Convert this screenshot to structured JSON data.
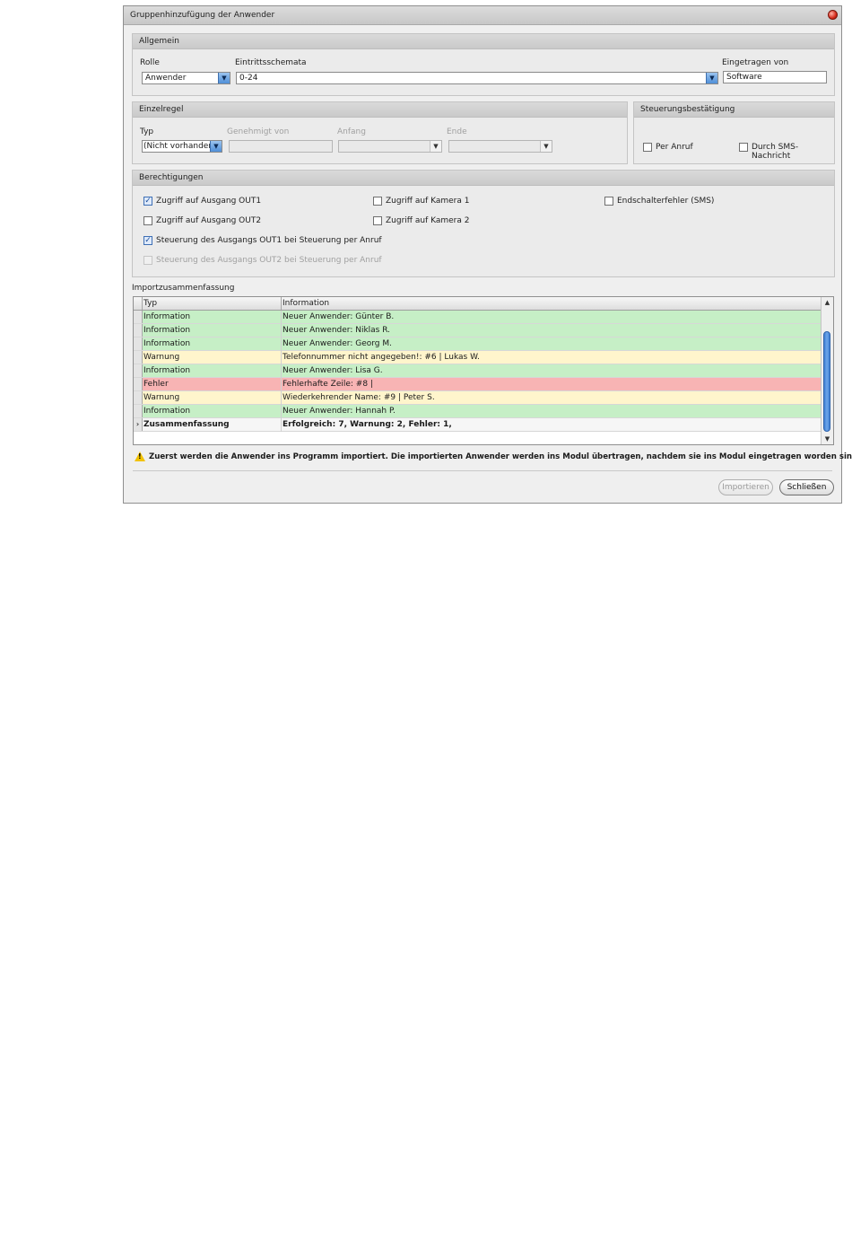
{
  "window": {
    "title": "Gruppenhinzufügung der Anwender"
  },
  "allgemein": {
    "header": "Allgemein",
    "role_label": "Rolle",
    "role_value": "Anwender",
    "schema_label": "Eintrittsschemata",
    "schema_value": "0-24",
    "registered_label": "Eingetragen von",
    "registered_value": "Software"
  },
  "einzelregel": {
    "header": "Einzelregel",
    "typ_label": "Typ",
    "typ_value": "(Nicht vorhanden)",
    "approved_label": "Genehmigt von",
    "start_label": "Anfang",
    "end_label": "Ende"
  },
  "steuerung": {
    "header": "Steuerungsbestätigung",
    "per_call": "Per Anruf",
    "per_sms": "Durch SMS-Nachricht"
  },
  "permissions": {
    "header": "Berechtigungen",
    "items": [
      {
        "label": "Zugriff auf Ausgang OUT1",
        "checked": true
      },
      {
        "label": "Zugriff auf Ausgang OUT2",
        "checked": false
      },
      {
        "label": "Steuerung des Ausgangs OUT1 bei Steuerung per Anruf",
        "checked": true
      },
      {
        "label": "Steuerung des Ausgangs OUT2 bei Steuerung per Anruf",
        "checked": false,
        "disabled": true
      },
      {
        "label": "Zugriff auf Kamera 1",
        "checked": false
      },
      {
        "label": "Zugriff auf Kamera 2",
        "checked": false
      },
      {
        "label": "Endschalterfehler (SMS)",
        "checked": false
      }
    ]
  },
  "import": {
    "section_label": "Importzusammenfassung",
    "columns": [
      "Typ",
      "Information"
    ],
    "rows": [
      {
        "type": "Information",
        "info": "Neuer Anwender: Günter B.",
        "kind": "info"
      },
      {
        "type": "Information",
        "info": "Neuer Anwender: Niklas R.",
        "kind": "info"
      },
      {
        "type": "Information",
        "info": "Neuer Anwender: Georg M.",
        "kind": "info"
      },
      {
        "type": "Warnung",
        "info": "Telefonnummer nicht angegeben!: #6 | Lukas W.",
        "kind": "warn"
      },
      {
        "type": "Information",
        "info": "Neuer Anwender: Lisa G.",
        "kind": "info"
      },
      {
        "type": "Fehler",
        "info": "Fehlerhafte Zeile: #8 |",
        "kind": "err"
      },
      {
        "type": "Warnung",
        "info": "Wiederkehrender Name: #9 | Peter S.",
        "kind": "warn"
      },
      {
        "type": "Information",
        "info": "Neuer Anwender: Hannah P.",
        "kind": "info"
      },
      {
        "type": "Zusammenfassung",
        "info": "Erfolgreich: 7, Warnung: 2, Fehler: 1,",
        "kind": "sum"
      }
    ],
    "note": "Zuerst werden die Anwender ins Programm importiert. Die importierten Anwender werden ins Modul übertragen, nachdem sie ins Modul eingetragen worden sind."
  },
  "buttons": {
    "import": "Importieren",
    "close": "Schließen"
  }
}
